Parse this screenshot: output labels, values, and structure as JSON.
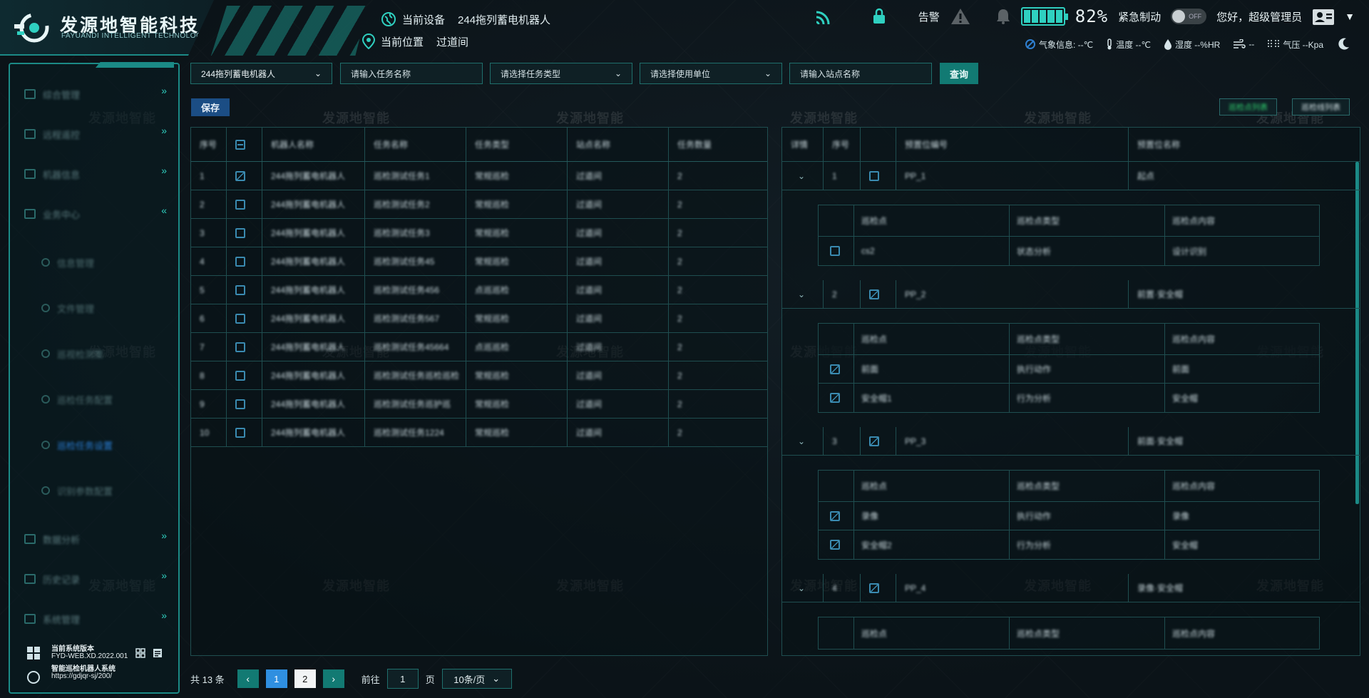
{
  "header": {
    "logo_cn": "发源地智能科技",
    "logo_en": "FAYUANDI INTELLIGENT TECHNOLOGY",
    "current_device_label": "当前设备",
    "current_device": "244拖列蓄电机器人",
    "current_location_label": "当前位置",
    "current_location": "过道间",
    "alarm_label": "告警",
    "battery_percent": "82%",
    "emergency_label": "紧急制动",
    "toggle_label": "OFF",
    "greeting": "您好，超级管理员",
    "weather": {
      "weather_label": "气象信息: --℃",
      "temp_label": "温度 --℃",
      "humidity_label": "湿度 --%HR",
      "wind_label": "--",
      "pressure_label": "气压 --Kpa"
    },
    "colors": {
      "accent": "#1b8a86",
      "battery": "#2fd0c0"
    }
  },
  "sidebar": {
    "items": [
      {
        "label": "综合管理",
        "chevron": "»"
      },
      {
        "label": "远程遥控",
        "chevron": "»"
      },
      {
        "label": "机器信息",
        "chevron": "»"
      },
      {
        "label": "业务中心",
        "chevron": "«"
      }
    ],
    "sub_items": [
      {
        "label": "信息管理"
      },
      {
        "label": "文件管理"
      },
      {
        "label": "巡视检测策"
      },
      {
        "label": "巡检任务配置"
      },
      {
        "label": "巡检任务设置"
      },
      {
        "label": "识别参数配置"
      }
    ],
    "bottom_items": [
      {
        "label": "数据分析",
        "chevron": "»"
      },
      {
        "label": "历史记录",
        "chevron": "»"
      },
      {
        "label": "系统管理",
        "chevron": "»"
      }
    ],
    "footer": {
      "version_label": "当前系统版本",
      "version": "FYD-WEB.XD.2022.001",
      "system_name": "智能巡检机器人系统",
      "url": "https://gdjqr-sj/200/"
    }
  },
  "filters": {
    "robot_select": "244拖列蓄电机器人",
    "task_name_placeholder": "请输入任务名称",
    "task_type_placeholder": "请选择任务类型",
    "unit_placeholder": "请选择使用单位",
    "site_placeholder": "请输入站点名称",
    "query_label": "查询",
    "save_label": "保存"
  },
  "left_table": {
    "headers": [
      "序号",
      "",
      "机器人名称",
      "任务名称",
      "任务类型",
      "站点名称",
      "任务数量"
    ],
    "rows": [
      {
        "idx": "1",
        "checked": true,
        "robot": "244拖列蓄电机器人",
        "task": "巡检测试任务1",
        "type": "常规巡检",
        "site": "过道间",
        "count": "2"
      },
      {
        "idx": "2",
        "checked": false,
        "robot": "244拖列蓄电机器人",
        "task": "巡检测试任务2",
        "type": "常规巡检",
        "site": "过道间",
        "count": "2"
      },
      {
        "idx": "3",
        "checked": false,
        "robot": "244拖列蓄电机器人",
        "task": "巡检测试任务3",
        "type": "常规巡检",
        "site": "过道间",
        "count": "2"
      },
      {
        "idx": "4",
        "checked": false,
        "robot": "244拖列蓄电机器人",
        "task": "巡检测试任务45",
        "type": "常规巡检",
        "site": "过道间",
        "count": "2"
      },
      {
        "idx": "5",
        "checked": false,
        "robot": "244拖列蓄电机器人",
        "task": "巡检测试任务456",
        "type": "点巡巡检",
        "site": "过道间",
        "count": "2"
      },
      {
        "idx": "6",
        "checked": false,
        "robot": "244拖列蓄电机器人",
        "task": "巡检测试任务567",
        "type": "常规巡检",
        "site": "过道间",
        "count": "2"
      },
      {
        "idx": "7",
        "checked": false,
        "robot": "244拖列蓄电机器人",
        "task": "巡检测试任务45664",
        "type": "点巡巡检",
        "site": "过道间",
        "count": "2"
      },
      {
        "idx": "8",
        "checked": false,
        "robot": "244拖列蓄电机器人",
        "task": "巡检测试任务巡检巡检",
        "type": "常规巡检",
        "site": "过道间",
        "count": "2"
      },
      {
        "idx": "9",
        "checked": false,
        "robot": "244拖列蓄电机器人",
        "task": "巡检测试任务巡护巡",
        "type": "常规巡检",
        "site": "过道间",
        "count": "2"
      },
      {
        "idx": "10",
        "checked": false,
        "robot": "244拖列蓄电机器人",
        "task": "巡检测试任务1224",
        "type": "常规巡检",
        "site": "过道间",
        "count": "2"
      }
    ]
  },
  "pager": {
    "total": "共 13 条",
    "pages": [
      "1",
      "2"
    ],
    "prev": "‹",
    "next": "›",
    "goto_label": "前往",
    "goto_value": "1",
    "page_unit": "页",
    "page_size": "10条/页"
  },
  "right_panel": {
    "tab_points": "巡检点列表",
    "tab_routes": "巡检线列表",
    "headers": [
      "详情",
      "序号",
      "",
      "预置位编号",
      "预置位名称"
    ],
    "groups": [
      {
        "idx": "1",
        "checked": false,
        "preset_no": "PP_1",
        "preset_name": "起点",
        "sub_headers": [
          "巡检点",
          "巡检点类型",
          "巡检点内容"
        ],
        "sub_rows": [
          {
            "checked": false,
            "point": "cs2",
            "type": "状态分析",
            "content": "设计识别"
          }
        ]
      },
      {
        "idx": "2",
        "checked": true,
        "preset_no": "PP_2",
        "preset_name": "前置·安全帽",
        "sub_headers": [
          "巡检点",
          "巡检点类型",
          "巡检点内容"
        ],
        "sub_rows": [
          {
            "checked": true,
            "point": "前面",
            "type": "执行动作",
            "content": "前面"
          },
          {
            "checked": true,
            "point": "安全帽1",
            "type": "行为分析",
            "content": "安全帽"
          }
        ]
      },
      {
        "idx": "3",
        "checked": true,
        "preset_no": "PP_3",
        "preset_name": "前面·安全帽",
        "sub_headers": [
          "巡检点",
          "巡检点类型",
          "巡检点内容"
        ],
        "sub_rows": [
          {
            "checked": true,
            "point": "录像",
            "type": "执行动作",
            "content": "录像"
          },
          {
            "checked": true,
            "point": "安全帽2",
            "type": "行为分析",
            "content": "安全帽"
          }
        ]
      },
      {
        "idx": "4",
        "checked": true,
        "preset_no": "PP_4",
        "preset_name": "录像·安全帽",
        "sub_headers": [
          "巡检点",
          "巡检点类型",
          "巡检点内容"
        ],
        "sub_rows": []
      }
    ]
  },
  "watermark": "发源地智能"
}
